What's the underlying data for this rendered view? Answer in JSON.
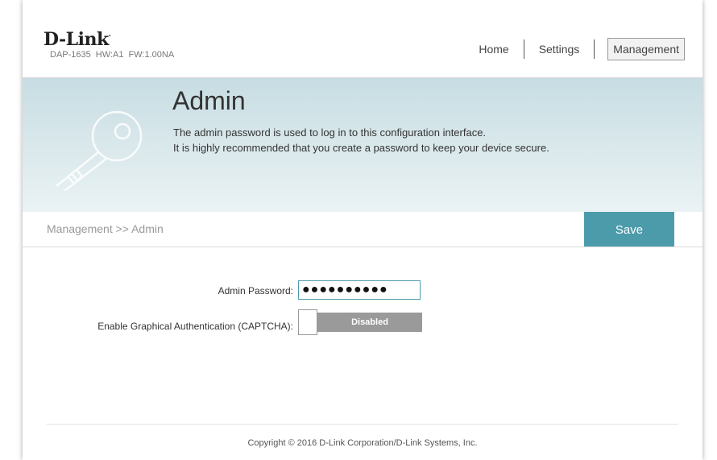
{
  "header": {
    "logo_text": "D-Link",
    "device_info": "DAP-1635  HW:A1  FW:1.00NA",
    "nav": {
      "home": "Home",
      "settings": "Settings",
      "management": "Management"
    }
  },
  "banner": {
    "title": "Admin",
    "description_line1": "The admin password is used to log in to this configuration interface.",
    "description_line2": "It is highly recommended that you create a password to keep your device secure.",
    "icon": "key-icon"
  },
  "breadcrumb": "Management >> Admin",
  "save_label": "Save",
  "form": {
    "password_label": "Admin Password:",
    "password_value": "●●●●●●●●●●",
    "captcha_label": "Enable Graphical Authentication (CAPTCHA):",
    "captcha_state": "Disabled"
  },
  "footer": {
    "copyright": "Copyright © 2016 D-Link Corporation/D-Link Systems, Inc."
  },
  "colors": {
    "accent": "#4c9bab",
    "toggle_off": "#9a9a9a",
    "banner": "#d4e6ea"
  }
}
